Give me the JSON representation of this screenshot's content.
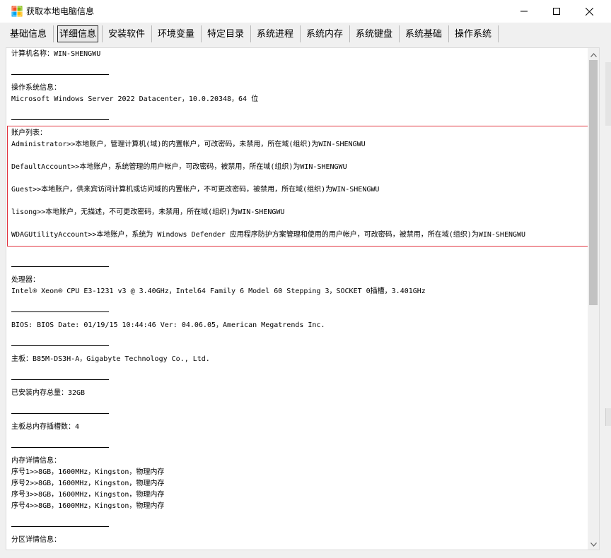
{
  "window": {
    "title": "获取本地电脑信息"
  },
  "tabs": [
    {
      "label": "基础信息",
      "active": false
    },
    {
      "label": "详细信息",
      "active": true
    },
    {
      "label": "安装软件",
      "active": false
    },
    {
      "label": "环境变量",
      "active": false
    },
    {
      "label": "特定目录",
      "active": false
    },
    {
      "label": "系统进程",
      "active": false
    },
    {
      "label": "系统内存",
      "active": false
    },
    {
      "label": "系统键盘",
      "active": false
    },
    {
      "label": "系统基础",
      "active": false
    },
    {
      "label": "操作系统",
      "active": false
    }
  ],
  "details": {
    "computer_name": "计算机名称：WIN-SHENGWU",
    "os_header": "操作系统信息：",
    "os_value": "Microsoft Windows Server 2022 Datacenter，10.0.20348，64 位",
    "accounts_header": "账户列表：",
    "accounts": [
      "Administrator>>本地账户，管理计算机(域)的内置帐户，可改密码，未禁用，所在域(组织)为WIN-SHENGWU",
      "DefaultAccount>>本地账户，系统管理的用户帐户，可改密码，被禁用，所在域(组织)为WIN-SHENGWU",
      "Guest>>本地账户，供来宾访问计算机或访问域的内置帐户，不可更改密码，被禁用，所在域(组织)为WIN-SHENGWU",
      "lisong>>本地账户，无描述，不可更改密码，未禁用，所在域(组织)为WIN-SHENGWU",
      "WDAGUtilityAccount>>本地账户，系统为 Windows Defender 应用程序防护方案管理和使用的用户帐户，可改密码，被禁用，所在域(组织)为WIN-SHENGWU"
    ],
    "cpu_header": "处理器：",
    "cpu_value": "Intel® Xeon® CPU E3-1231 v3 @ 3.40GHz，Intel64 Family 6 Model 60 Stepping 3，SOCKET 0插槽，3.401GHz",
    "bios": "BIOS: BIOS Date: 01/19/15 10:44:46 Ver: 04.06.05，American Megatrends Inc.",
    "motherboard": "主板：B85M-DS3H-A，Gigabyte Technology Co., Ltd.",
    "ram_total": "已安装内存总量：32GB",
    "ram_slots": "主板总内存插槽数：4",
    "memory_header": "内存详情信息：",
    "memory": [
      "序号1>>8GB，1600MHz，Kingston，物理内存",
      "序号2>>8GB，1600MHz，Kingston，物理内存",
      "序号3>>8GB，1600MHz，Kingston，物理内存",
      "序号4>>8GB，1600MHz，Kingston，物理内存"
    ],
    "partition_header": "分区详情信息："
  },
  "colors": {
    "highlight_border": "#e1343f",
    "active_tab_border": "#2a2a2a",
    "window_bg": "#f0f0f0"
  },
  "icons": {
    "app": "app-icon",
    "minimize": "minimize-icon",
    "maximize": "maximize-icon",
    "close": "close-icon",
    "scroll_up": "chevron-up-icon",
    "scroll_down": "chevron-down-icon"
  }
}
